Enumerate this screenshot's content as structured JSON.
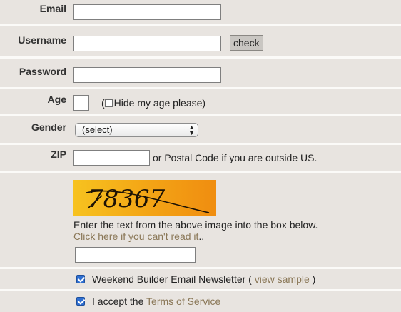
{
  "form": {
    "email": {
      "label": "Email",
      "value": ""
    },
    "username": {
      "label": "Username",
      "value": "",
      "check_label": "check"
    },
    "password": {
      "label": "Password",
      "value": ""
    },
    "age": {
      "label": "Age",
      "value": "",
      "paren_open": "(",
      "hide_label": "Hide my age please)"
    },
    "gender": {
      "label": "Gender",
      "selected": "(select)"
    },
    "zip": {
      "label": "ZIP",
      "value": "",
      "note": "or Postal Code if you are outside US."
    },
    "captcha": {
      "image_text": "78367",
      "instruction": "Enter the text from the above image into the box below.",
      "help_link": "Click here if you can't read it",
      "help_suffix": "..",
      "value": ""
    },
    "newsletter": {
      "checked": true,
      "label": "Weekend Builder Email Newsletter (",
      "link": "view sample",
      "close": ")"
    },
    "terms": {
      "checked": true,
      "label": "I accept the",
      "link": "Terms of Service"
    }
  },
  "colors": {
    "background": "#e8e4e0",
    "separator": "#fbfaf8",
    "link": "#8a7757",
    "checkbox": "#2f6fd1"
  }
}
